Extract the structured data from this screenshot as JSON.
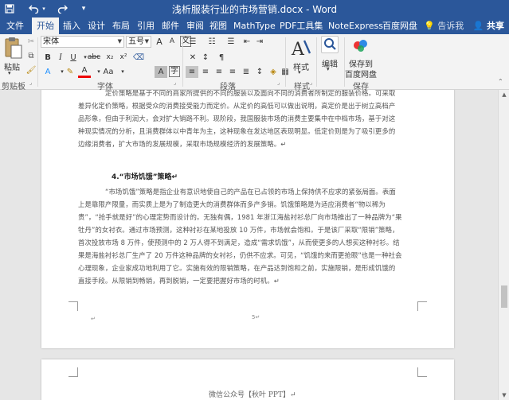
{
  "window": {
    "title": "浅析服装行业的市场营销.docx - Word"
  },
  "quick_access": {
    "save_icon": "save-icon",
    "undo_icon": "undo-icon",
    "redo_icon": "redo-icon"
  },
  "tabs": [
    "文件",
    "开始",
    "插入",
    "设计",
    "布局",
    "引用",
    "邮件",
    "审阅",
    "视图",
    "MathType",
    "PDF工具集",
    "NoteExpress",
    "百度网盘"
  ],
  "active_tab": "开始",
  "tell_me": "告诉我",
  "share": "共享",
  "ribbon": {
    "clipboard": {
      "paste": "粘贴",
      "label": "剪贴板"
    },
    "font": {
      "name": "宋体",
      "size": "五号",
      "label": "字体",
      "b": "B",
      "i": "I",
      "u": "U",
      "strike": "abc",
      "sub": "x₂",
      "sup": "x²",
      "grow": "A",
      "shrink": "A",
      "clear": "A"
    },
    "paragraph": {
      "label": "段落"
    },
    "styles": {
      "label": "样式",
      "button": "样式"
    },
    "editing": {
      "button": "编辑"
    },
    "save": {
      "button_line1": "保存到",
      "button_line2": "百度网盘",
      "label": "保存"
    }
  },
  "document": {
    "para1": [
      "定价策略是基于不同的商家所提供的不同的服装以及面向不同的消费者所制定的服装价格。可采取",
      "差异化定价策略，根据受众的消费接受能力而定价。从定价的高低可以做出说明，高定价是出于树立高档产",
      "品形象，但由于利润大，会对扩大销路不利。现阶段，我国服装市场的消费主要集中在中档市场，基于对这",
      "种现实情况的分析，且消费群体以中青年为主，这种现象在发达地区表现明显。低定价则是为了吸引更多的",
      "边缘消费者，扩大市场的发展规模，采取市场规模经济的发展策略。↵"
    ],
    "heading": "4.“市场饥饿”策略↵",
    "para2": [
      "“市场饥饿”策略是指企业有意识地使自己的产品在已占领的市场上保持供不应求的紧张局面。表面",
      "上是靠限产限量，而实质上是为了制造更大的消费群体而多产多销。饥饿策略是为适应消费者“物以稀为",
      "贵”，“抢手就是好”的心理定势而设计的。无独有偶，1981 年浙江海盐衬衫总厂向市场推出了一种品牌为“果",
      "牡丹”的女衬衣。通过市场预测，这种衬衫在某地投放 10 万件，市场就会饱和。于是该厂采取“限销”策略，",
      "首次投放市场 8 万件，使预测中的 2 万人得不到满足，造成“需求饥饿”，从而使更多的人想买这种衬衫。结",
      "果是海盐衬衫总厂生产了 20 万件这种品牌的女衬衫，仍供不应求。可见，“饥饿的来而更抢眼”也是一种社会",
      "心理现象，企业家成功地利用了它。实施有效的限销策略，在产品达到饱和之前，实施限销，是形成饥饿的",
      "直接手段。从限销到畅销，再到脱销，一定要把握好市场的时机。↵"
    ],
    "page_number": "5↵",
    "end_mark": "↵",
    "footer": "微信公众号【秋叶 PPT】↵"
  }
}
